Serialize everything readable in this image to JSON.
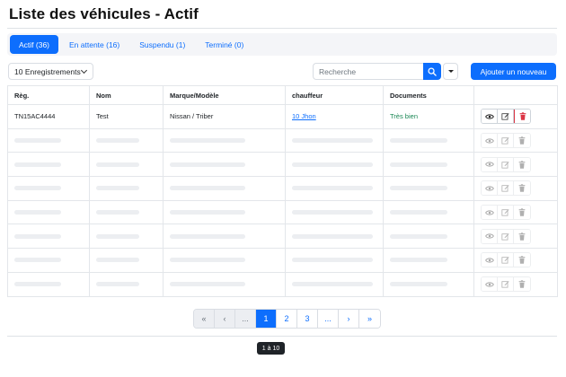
{
  "page": {
    "title": "Liste des véhicules - Actif"
  },
  "tabs": [
    {
      "label": "Actif (36)",
      "active": true
    },
    {
      "label": "En attente (16)",
      "active": false
    },
    {
      "label": "Suspendu (1)",
      "active": false
    },
    {
      "label": "Terminé (0)",
      "active": false
    }
  ],
  "toolbar": {
    "per_page": "10 Enregistrements",
    "search_placeholder": "Recherche",
    "add_label": "Ajouter un nouveau"
  },
  "table": {
    "columns": [
      "Règ.",
      "Nom",
      "Marque/Modèle",
      "chauffeur",
      "Documents",
      ""
    ],
    "rows": [
      {
        "reg": "TN15AC4444",
        "name": "Test",
        "model": "Nissan / Triber",
        "driver": "10 Jhon",
        "documents": "Très bien"
      }
    ],
    "placeholder_rows": 7
  },
  "pagination": {
    "items": [
      "«",
      "‹",
      "...",
      "1",
      "2",
      "3",
      "...",
      "›",
      "»"
    ],
    "current": "1"
  },
  "range_label": "1 à 10",
  "colors": {
    "primary": "#0d6efd",
    "success": "#198754",
    "danger": "#dc3545"
  },
  "icons": {
    "search": "search-icon",
    "view": "eye-icon",
    "edit": "edit-icon",
    "delete": "trash-icon",
    "dropdown": "chevron-down-icon"
  }
}
